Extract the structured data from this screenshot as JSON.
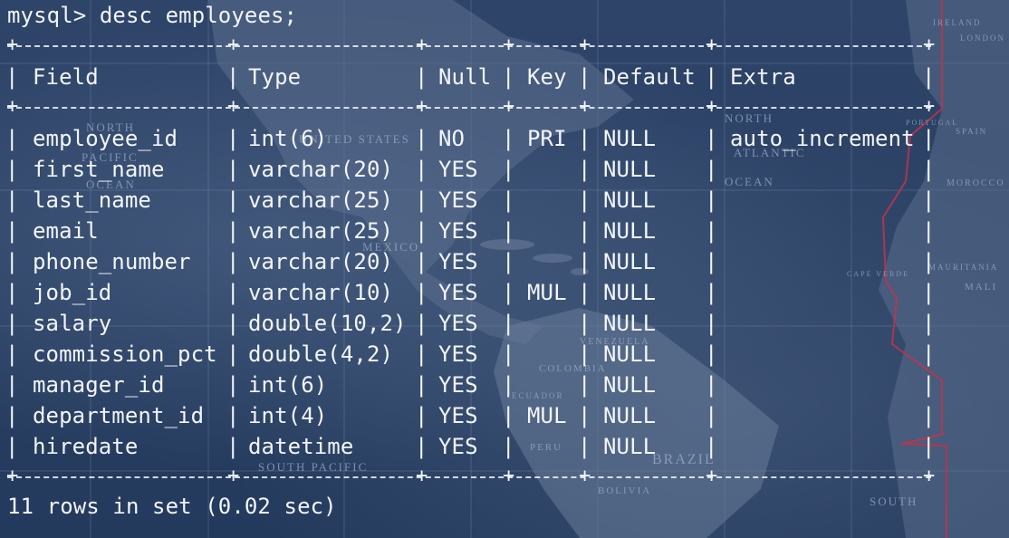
{
  "terminal": {
    "prompt": "mysql>",
    "command": "desc employees;",
    "footer": "11 rows in set (0.02 sec)"
  },
  "table": {
    "headers": {
      "field": "Field",
      "type": "Type",
      "null": "Null",
      "key": "Key",
      "default": "Default",
      "extra": "Extra"
    },
    "rows": [
      {
        "field": "employee_id",
        "type": "int(6)",
        "null": "NO",
        "key": "PRI",
        "default": "NULL",
        "extra": "auto_increment"
      },
      {
        "field": "first_name",
        "type": "varchar(20)",
        "null": "YES",
        "key": "",
        "default": "NULL",
        "extra": ""
      },
      {
        "field": "last_name",
        "type": "varchar(25)",
        "null": "YES",
        "key": "",
        "default": "NULL",
        "extra": ""
      },
      {
        "field": "email",
        "type": "varchar(25)",
        "null": "YES",
        "key": "",
        "default": "NULL",
        "extra": ""
      },
      {
        "field": "phone_number",
        "type": "varchar(20)",
        "null": "YES",
        "key": "",
        "default": "NULL",
        "extra": ""
      },
      {
        "field": "job_id",
        "type": "varchar(10)",
        "null": "YES",
        "key": "MUL",
        "default": "NULL",
        "extra": ""
      },
      {
        "field": "salary",
        "type": "double(10,2)",
        "null": "YES",
        "key": "",
        "default": "NULL",
        "extra": ""
      },
      {
        "field": "commission_pct",
        "type": "double(4,2)",
        "null": "YES",
        "key": "",
        "default": "NULL",
        "extra": ""
      },
      {
        "field": "manager_id",
        "type": "int(6)",
        "null": "YES",
        "key": "",
        "default": "NULL",
        "extra": ""
      },
      {
        "field": "department_id",
        "type": "int(4)",
        "null": "YES",
        "key": "MUL",
        "default": "NULL",
        "extra": ""
      },
      {
        "field": "hiredate",
        "type": "datetime",
        "null": "YES",
        "key": "",
        "default": "NULL",
        "extra": ""
      }
    ]
  },
  "background": {
    "map_labels": [
      "NORTH",
      "PACIFIC",
      "OCEAN",
      "UNITED STATES",
      "MEXICO",
      "ATLANTIC",
      "OCEAN",
      "NORTH",
      "COLOMBIA",
      "VENEZUELA",
      "BRAZIL",
      "SOUTH PACIFIC",
      "BOLIVIA",
      "PERU",
      "ECUADOR",
      "PORTUGAL",
      "SPAIN",
      "MOROCCO",
      "MAURITANIA",
      "MALI",
      "CAPE VERDE",
      "SOUTH",
      "LONDON",
      "IRELAND"
    ],
    "colors": {
      "ocean": "#2a3f63",
      "land": "#5d708f",
      "grid": "#7a90b5",
      "timezone_line": "#c2334a"
    }
  }
}
